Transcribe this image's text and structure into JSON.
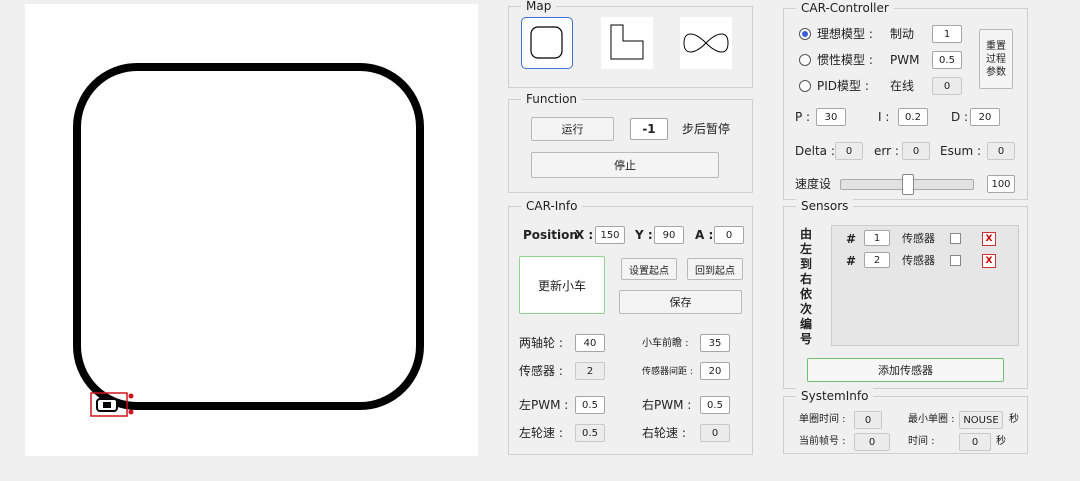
{
  "map": {
    "title": "Map",
    "shapes": [
      "rounded-square-icon",
      "l-shape-icon",
      "figure-eight-icon"
    ]
  },
  "function": {
    "title": "Function",
    "run_label": "运行",
    "step_value": "-1",
    "step_suffix": "步后暂停",
    "stop_label": "停止"
  },
  "car_info": {
    "title": "CAR-Info",
    "position_label": "Position",
    "x_label": "X :",
    "x_value": "150",
    "y_label": "Y :",
    "y_value": "90",
    "a_label": "A :",
    "a_value": "0",
    "update_car_label": "更新小车",
    "set_start_label": "设置起点",
    "back_start_label": "回到起点",
    "save_label": "保存",
    "wheelbase_label": "两轴轮 :",
    "wheelbase_value": "40",
    "lookahead_label": "小车前瞻 :",
    "lookahead_value": "35",
    "sensors_label": "传感器 :",
    "sensors_value": "2",
    "sensor_gap_label": "传感器间距 :",
    "sensor_gap_value": "20",
    "left_pwm_label": "左PWM :",
    "left_pwm_value": "0.5",
    "right_pwm_label": "右PWM :",
    "right_pwm_value": "0.5",
    "left_speed_label": "左轮速 :",
    "left_speed_value": "0.5",
    "right_speed_label": "右轮速 :",
    "right_speed_value": "0"
  },
  "controller": {
    "title": "CAR-Controller",
    "ideal_label": "理想模型 :",
    "brake_label": "制动",
    "brake_value": "1",
    "inertia_label": "惯性模型 :",
    "pwm_label": "PWM",
    "pwm_value": "0.5",
    "pid_label": "PID模型 :",
    "online_label": "在线",
    "online_value": "0",
    "reset_label": "重置过程参数",
    "p_label": "P :",
    "p_value": "30",
    "i_label": "I :",
    "i_value": "0.2",
    "d_label": "D :",
    "d_value": "20",
    "delta_label": "Delta :",
    "delta_value": "0",
    "err_label": "err :",
    "err_value": "0",
    "esum_label": "Esum :",
    "esum_value": "0",
    "speed_label": "速度设",
    "speed_value": "100",
    "speed_level": 0.5
  },
  "sensors": {
    "title": "Sensors",
    "vertical_label": "由左到右依次编号",
    "items": [
      {
        "hash": "#",
        "index": "1",
        "label": "传感器"
      },
      {
        "hash": "#",
        "index": "2",
        "label": "传感器"
      }
    ],
    "add_label": "添加传感器"
  },
  "system_info": {
    "title": "SystemInfo",
    "lap_time_label": "单圈时间 :",
    "lap_time_value": "0",
    "min_lap_label": "最小单圈 :",
    "min_lap_value": "NOUSE",
    "min_lap_unit": "秒",
    "frame_label": "当前帧号 :",
    "frame_value": "0",
    "time_label": "时间 :",
    "time_value": "0",
    "time_unit": "秒"
  },
  "colors": {
    "accent": "#3b5bdb",
    "update_border": "#8ed38e",
    "car_red": "#d0121b",
    "track": "#000000"
  }
}
